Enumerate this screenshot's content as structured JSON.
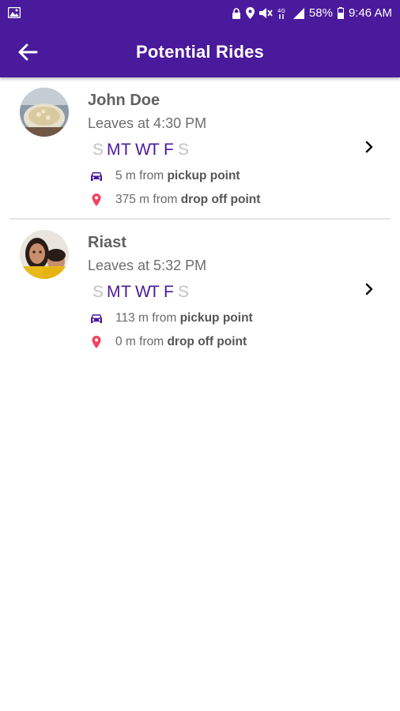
{
  "status_bar": {
    "battery": "58%",
    "time": "9:46 AM"
  },
  "header": {
    "title": "Potential Rides"
  },
  "rides": [
    {
      "name": "John Doe",
      "leaves": "Leaves at 4:30 PM",
      "days": [
        {
          "letter": "S",
          "active": false
        },
        {
          "letter": "M",
          "active": true
        },
        {
          "letter": "T",
          "active": true
        },
        {
          "letter": "W",
          "active": true
        },
        {
          "letter": "T",
          "active": true
        },
        {
          "letter": "F",
          "active": true
        },
        {
          "letter": "S",
          "active": false
        }
      ],
      "pickup_distance": "5 m from ",
      "pickup_label": "pickup point",
      "dropoff_distance": "375 m from ",
      "dropoff_label": "drop off point"
    },
    {
      "name": "Riast",
      "leaves": "Leaves at 5:32 PM",
      "days": [
        {
          "letter": "S",
          "active": false
        },
        {
          "letter": "M",
          "active": true
        },
        {
          "letter": "T",
          "active": true
        },
        {
          "letter": "W",
          "active": true
        },
        {
          "letter": "T",
          "active": true
        },
        {
          "letter": "F",
          "active": true
        },
        {
          "letter": "S",
          "active": false
        }
      ],
      "pickup_distance": "113 m from ",
      "pickup_label": "pickup point",
      "dropoff_distance": "0 m from ",
      "dropoff_label": "drop off point"
    }
  ],
  "colors": {
    "primary": "#4a1a9c",
    "day_inactive": "#c2c2c2",
    "pin": "#f04461"
  },
  "icons": {
    "back": "arrow-left-icon",
    "car": "car-icon",
    "pin": "location-pin-icon",
    "chevron": "chevron-right-icon"
  }
}
